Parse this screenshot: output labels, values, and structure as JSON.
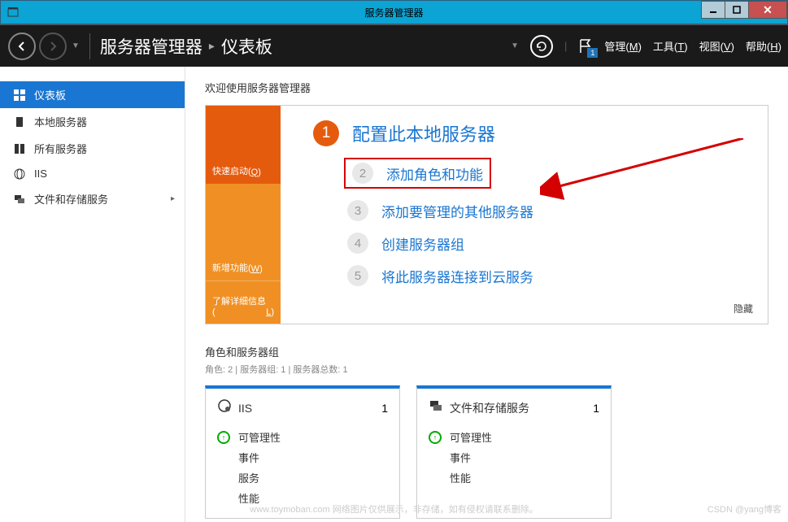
{
  "titlebar": {
    "title": "服务器管理器"
  },
  "topnav": {
    "breadcrumb": {
      "root": "服务器管理器",
      "current": "仪表板"
    },
    "flag_count": "1",
    "menu": {
      "manage": "管理(M)",
      "tools": "工具(T)",
      "view": "视图(V)",
      "help": "帮助(H)"
    }
  },
  "sidebar": {
    "items": [
      {
        "label": "仪表板"
      },
      {
        "label": "本地服务器"
      },
      {
        "label": "所有服务器"
      },
      {
        "label": "IIS"
      },
      {
        "label": "文件和存储服务"
      }
    ]
  },
  "welcome": {
    "heading": "欢迎使用服务器管理器",
    "side": {
      "quick": "快速启动(Q)",
      "new": "新增功能(W)",
      "learn": "了解详细信息(L)"
    },
    "steps": {
      "s1": "配置此本地服务器",
      "s2": "添加角色和功能",
      "s3": "添加要管理的其他服务器",
      "s4": "创建服务器组",
      "s5": "将此服务器连接到云服务"
    },
    "hide": "隐藏"
  },
  "roles": {
    "title": "角色和服务器组",
    "subtitle": "角色: 2 | 服务器组: 1 | 服务器总数: 1",
    "tiles": [
      {
        "name": "IIS",
        "count": "1",
        "rows": [
          "可管理性",
          "事件",
          "服务",
          "性能"
        ]
      },
      {
        "name": "文件和存储服务",
        "count": "1",
        "rows": [
          "可管理性",
          "事件",
          "性能"
        ]
      }
    ]
  },
  "watermark": "www.toymoban.com 网络图片仅供展示，非存储，如有侵权请联系删除。",
  "csdn": "CSDN @yang博客"
}
